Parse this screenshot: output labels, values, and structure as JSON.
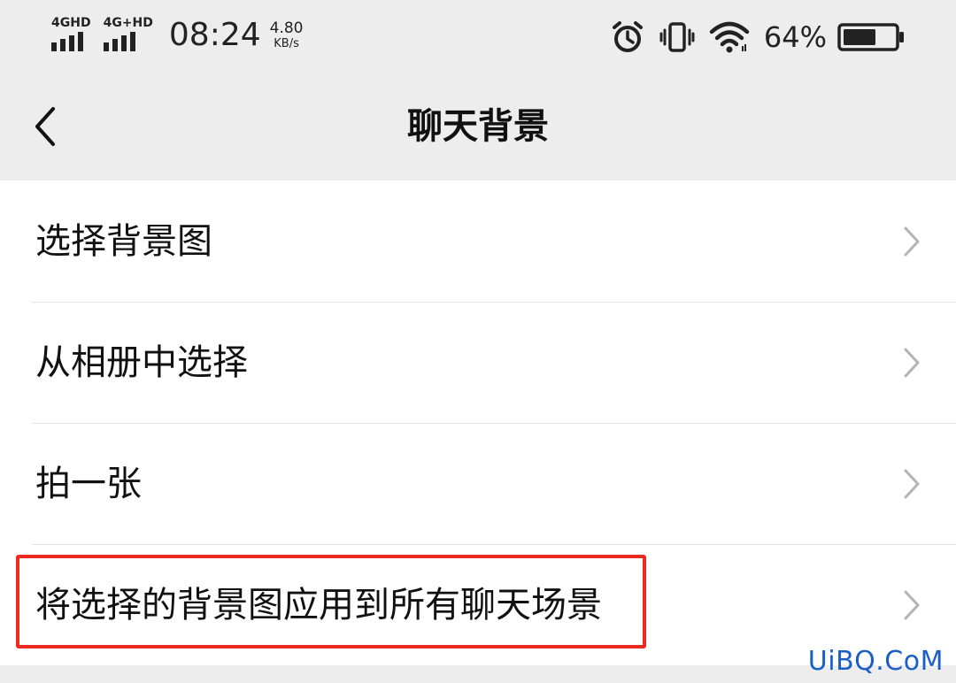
{
  "status_bar": {
    "sim1_label": "4GHD",
    "sim2_label": "4G+HD",
    "time": "08:24",
    "net_speed_value": "4.80",
    "net_speed_unit": "KB/s",
    "battery_percent": "64%",
    "battery_level": 0.64,
    "icons": [
      "alarm-icon",
      "vibrate-icon",
      "wifi-icon",
      "battery-icon"
    ]
  },
  "nav": {
    "back_icon": "chevron-left-icon",
    "title": "聊天背景"
  },
  "menu": {
    "items": [
      {
        "label": "选择背景图"
      },
      {
        "label": "从相册中选择"
      },
      {
        "label": "拍一张"
      },
      {
        "label": "将选择的背景图应用到所有聊天场景"
      }
    ],
    "chevron_icon": "chevron-right-icon"
  },
  "annotation": {
    "highlight_color": "#ee2a20",
    "highlighted_item_index": 3
  },
  "watermark": {
    "text": "UiBQ.CoM",
    "color": "#1a5fc8"
  }
}
